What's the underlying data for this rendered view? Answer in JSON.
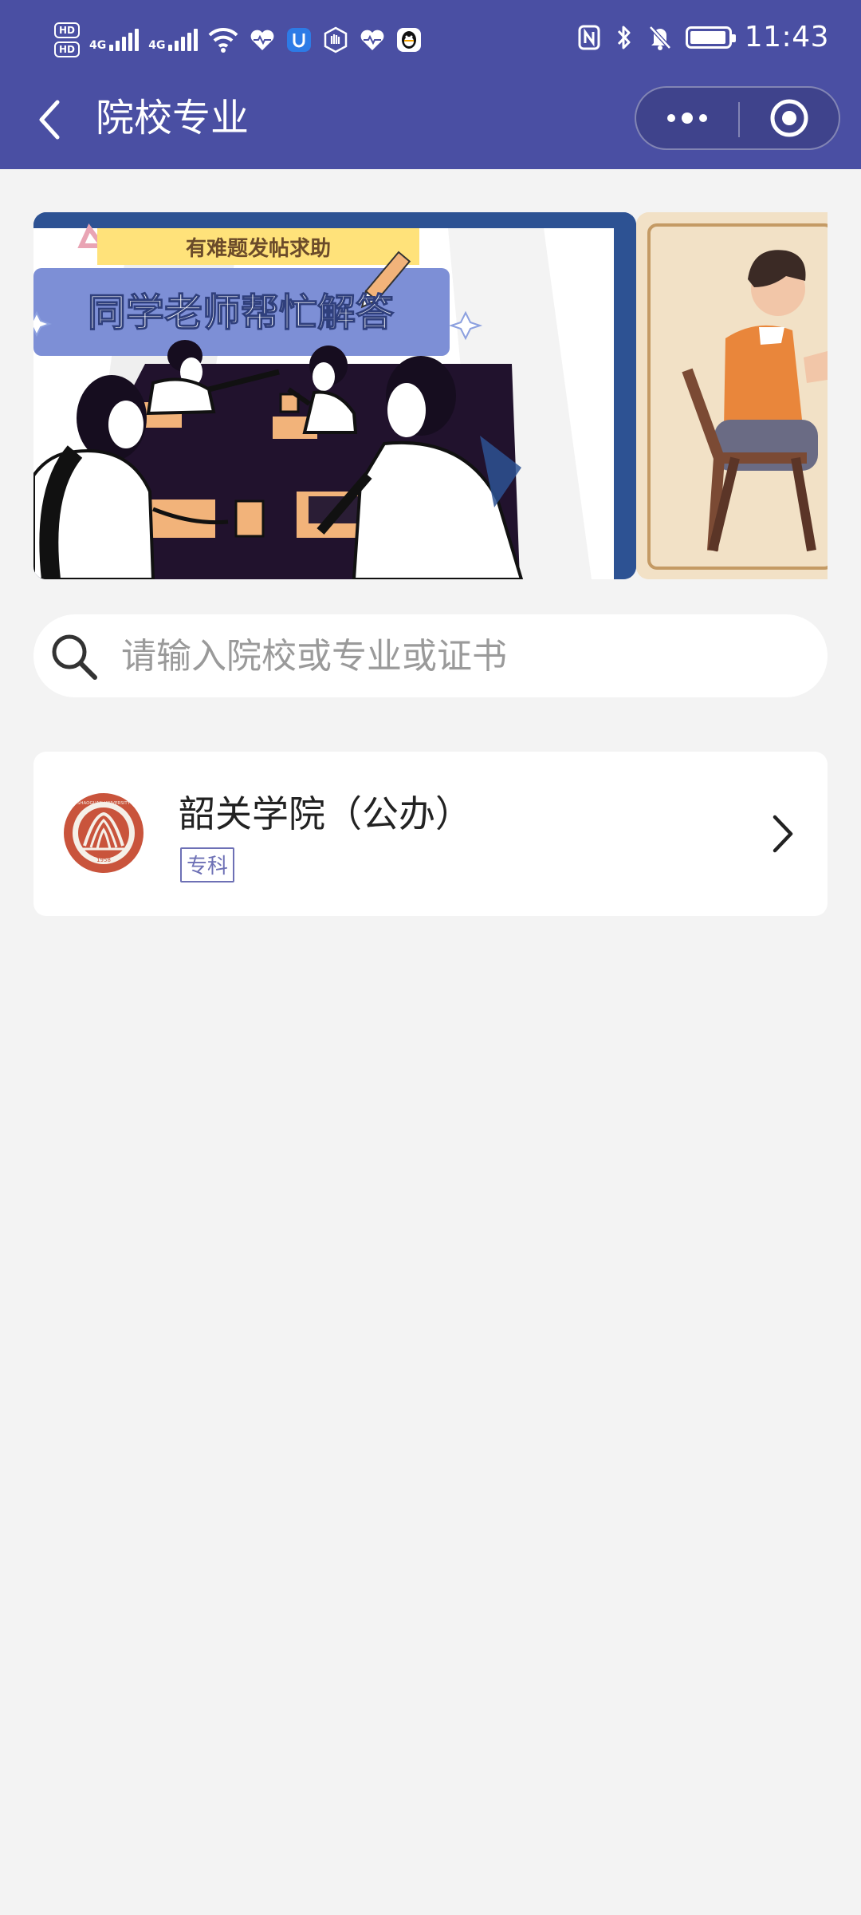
{
  "status_bar": {
    "time": "11:43",
    "hd1": "HD",
    "hd2": "HD",
    "net1": "4G",
    "net2": "4G"
  },
  "nav": {
    "title": "院校专业"
  },
  "banner": {
    "subtitle": "有难题发帖求助",
    "headline": "同学老师帮忙解答"
  },
  "search": {
    "placeholder": "请输入院校或专业或证书"
  },
  "schools": [
    {
      "name": "韶关学院（公办）",
      "tag": "专科",
      "logo_text": "SHAOGUAN UNIVERSITY",
      "logo_year": "1958"
    }
  ],
  "colors": {
    "header": "#4a4fa3",
    "tag": "#6d70b5",
    "background": "#f3f3f3"
  }
}
